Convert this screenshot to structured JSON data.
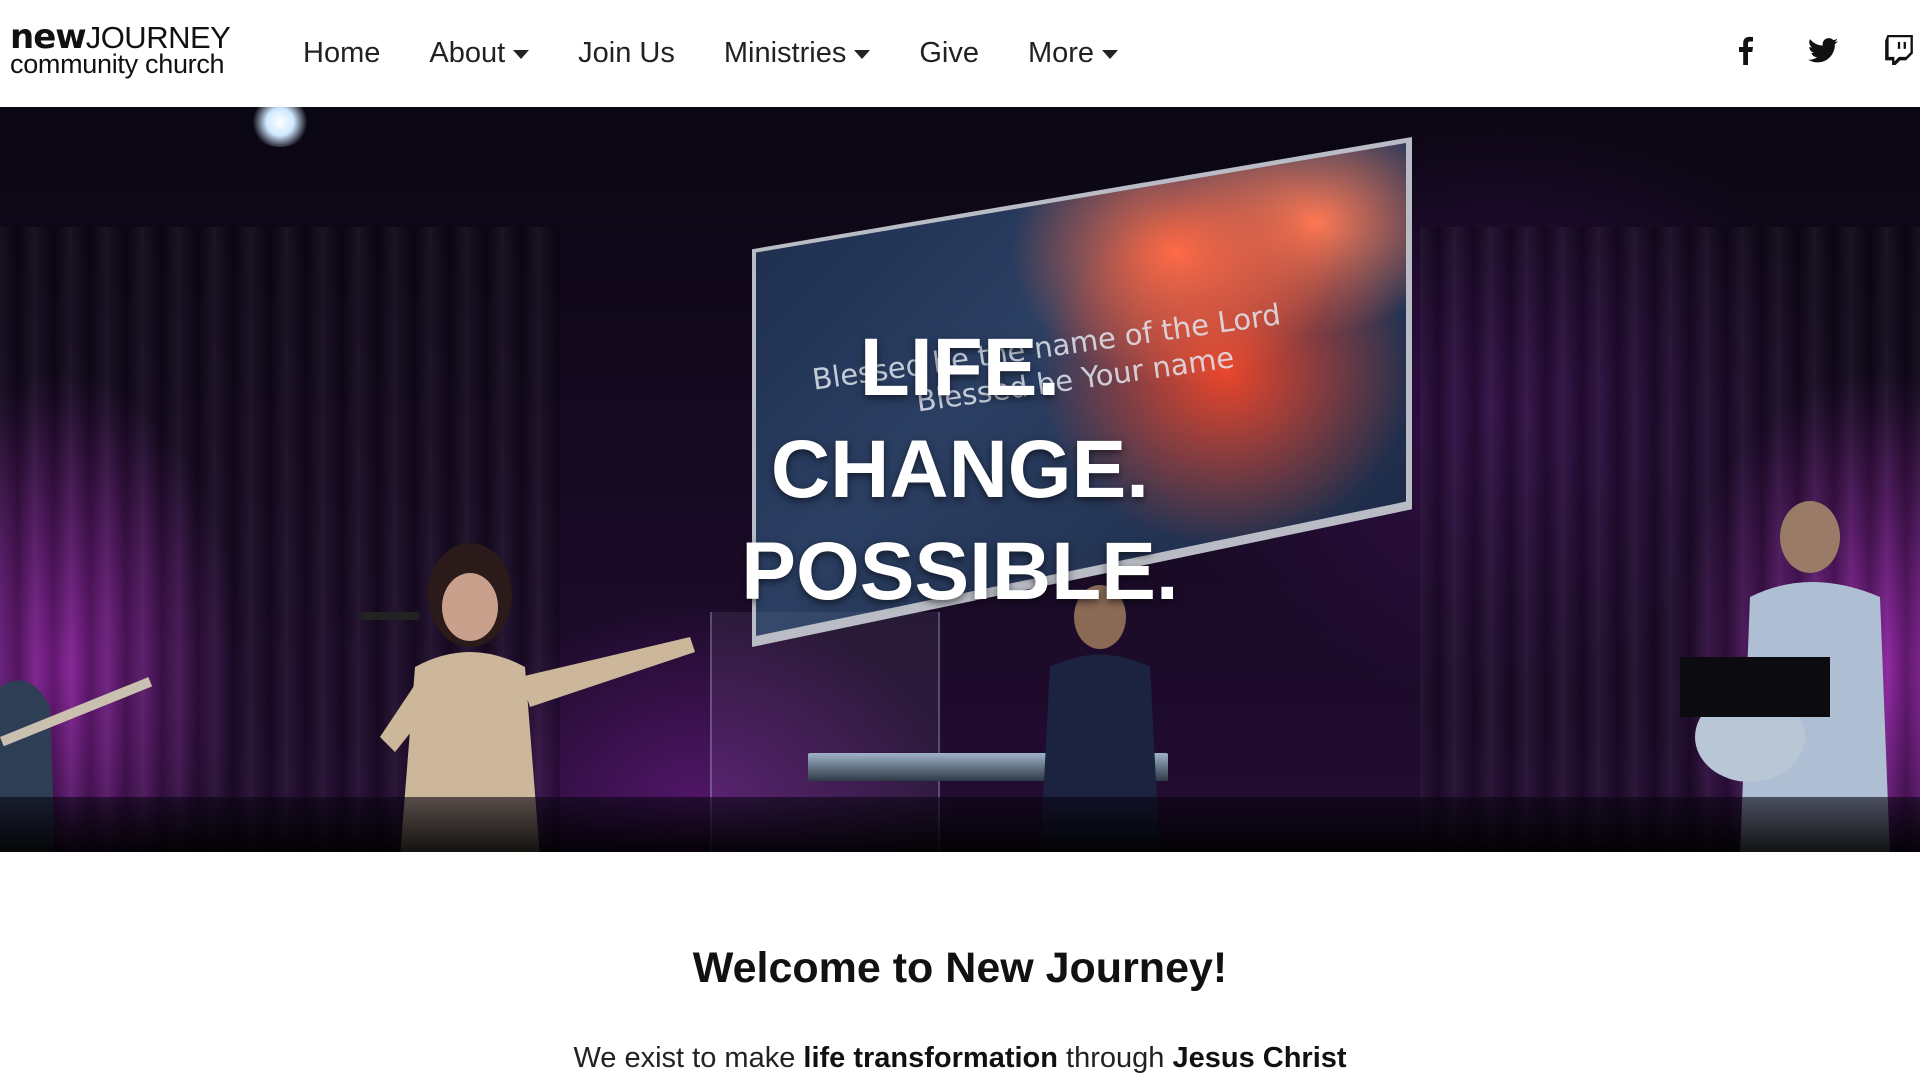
{
  "header": {
    "logo": {
      "new": "new",
      "journey": "JOURNEY",
      "subtitle": "community church"
    },
    "nav": [
      {
        "label": "Home",
        "dropdown": false
      },
      {
        "label": "About",
        "dropdown": true
      },
      {
        "label": "Join Us",
        "dropdown": false
      },
      {
        "label": "Ministries",
        "dropdown": true
      },
      {
        "label": "Give",
        "dropdown": false
      },
      {
        "label": "More",
        "dropdown": true
      }
    ],
    "social_icons": [
      "facebook-icon",
      "twitter-icon",
      "twitch-icon"
    ]
  },
  "hero": {
    "tagline": [
      "LIFE.",
      "CHANGE.",
      "POSSIBLE."
    ],
    "screen_lyrics": [
      "Blessed be the name of the Lord",
      "Blessed be Your name"
    ]
  },
  "welcome": {
    "title": "Welcome to New Journey!",
    "text_part1": "We exist to make ",
    "text_bold1": "life transformation",
    "text_part2": " through ",
    "text_bold2": "Jesus Christ"
  },
  "colors": {
    "text": "#111111",
    "header_bg": "#ffffff",
    "hero_accent": "#aa28be",
    "screen_red": "#e8452a"
  }
}
